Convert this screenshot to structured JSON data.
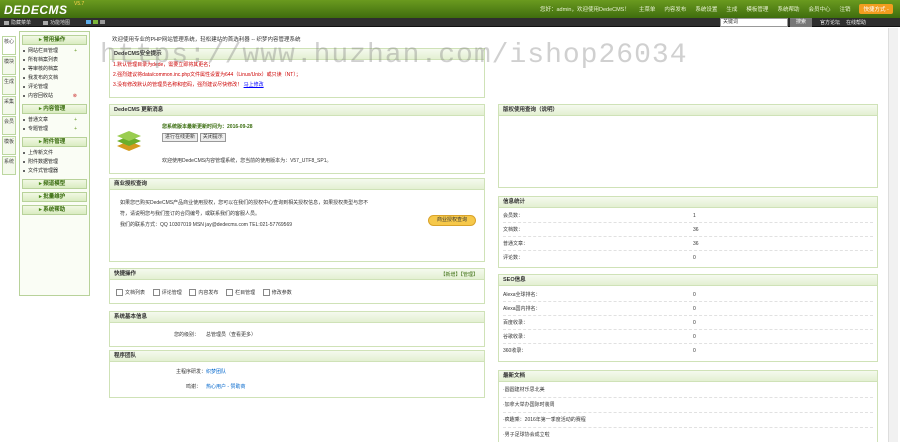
{
  "brand": {
    "logo": "DEDECMS",
    "version": "V5.7"
  },
  "topnav": [
    "您好：admin，欢迎使用DedeCMS！",
    "主菜单",
    "内容发布",
    "系统设置",
    "生成",
    "模板管理",
    "系统帮助",
    "会员中心",
    "注销"
  ],
  "topnav_btn": "快捷方式 -",
  "secbar": {
    "items": [
      "隐藏菜单",
      "功能地图"
    ],
    "keyword_label": "关键词",
    "keyword_placeholder": "搜索",
    "search_btn": "搜索",
    "right": [
      "官方论坛",
      "在线帮助"
    ]
  },
  "vtabs": [
    "核心",
    "模块",
    "生成",
    "采集",
    "会员",
    "模板",
    "系统"
  ],
  "menu": [
    {
      "title": "常用操作",
      "items": [
        "网站栏目管理",
        "所有档案列表",
        "等审核的档案",
        "我发布的文档",
        "评论管理",
        "内容回收站"
      ]
    },
    {
      "title": "内容管理",
      "items": [
        "普通文章",
        "专题管理"
      ]
    },
    {
      "title": "附件管理",
      "items": [
        "上传新文件",
        "附件数据管理",
        "文件式管理器"
      ]
    },
    {
      "title": "频道模型",
      "items": []
    },
    {
      "title": "批量维护",
      "items": []
    },
    {
      "title": "系统帮助",
      "items": []
    }
  ],
  "welcome": "欢迎使用专业的PHP网站管理系统，轻松建站的首选利器 -- 织梦内容管理系统",
  "watermark": "https://www.huzhan.com/ishop26034",
  "warn_panel": {
    "title": "DedeCMS安全提示",
    "lines": [
      "1.默认管理目录为dede，需要立即将其更名；",
      "2.强烈建议将data/common.inc.php文件属性设置为644（Linux/Unix）或只读（NT）；",
      "3.没有修改默认的管理员名称和密码，强烈建议尽快修改！"
    ],
    "link": "马上修改"
  },
  "update_panel": {
    "title": "DedeCMS 更新消息",
    "head": "您系统版本最新更新时间为：2016-09-28",
    "btn1": "进行在线更新",
    "btn2": "关闭提示",
    "desc": "欢迎使用DedeCMS内容管理系统，您当前的使用版本为：V57_UTF8_SP1。"
  },
  "right_top_panel": {
    "title": "版权使用查询（说明）"
  },
  "biz_panel": {
    "title": "商业授权查询",
    "lines": [
      "如果您已购买DedeCMS产品商业使用授权，您可以在我们的授权中心查询到相关授权信息，如果授权类型与您不",
      "符，请说明您与我们签订的合同编号，或联系我们的客服人员。",
      "我们的联系方式：QQ 10307019 MSN jay@dedecms.com TEL:021-57769569"
    ],
    "btn": "商业授权查询"
  },
  "quick_panel": {
    "title": "快捷操作",
    "right": "【新增】【管理】",
    "items": [
      "文档列表",
      "评论管理",
      "内容发布",
      "栏目管理",
      "修改参数"
    ]
  },
  "sysinfo_panel": {
    "title": "系统基本信息",
    "label": "您的级别：",
    "value": "总管理员（查看更多）"
  },
  "team_panel": {
    "title": "程序团队",
    "r1_label": "主程序研发：",
    "r1_value": "织梦团队",
    "r2_label": "鸣谢：",
    "r2_value": "热心用户 - 赞助商"
  },
  "stats_panel": {
    "title": "信息统计",
    "rows": [
      [
        "会员数：",
        "1"
      ],
      [
        "文档数：",
        "36"
      ],
      [
        "普通文章：",
        "36"
      ],
      [
        "评论数：",
        "0"
      ]
    ]
  },
  "seo_panel": {
    "title": "SEO信息",
    "rows": [
      [
        "Alexa全球排名：",
        "0"
      ],
      [
        "Alexa国内排名：",
        "0"
      ],
      [
        "百度收录：",
        "0"
      ],
      [
        "谷歌收录：",
        "0"
      ],
      [
        "360收录：",
        "0"
      ]
    ]
  },
  "news_panel": {
    "title": "最新文档",
    "items": [
      "·圆圆建材乐思北美",
      "·加拿大举办国际时装周",
      "·疯趣乘：2016年第一季度活动的赛程",
      "·男子足球协会成立啦"
    ]
  }
}
